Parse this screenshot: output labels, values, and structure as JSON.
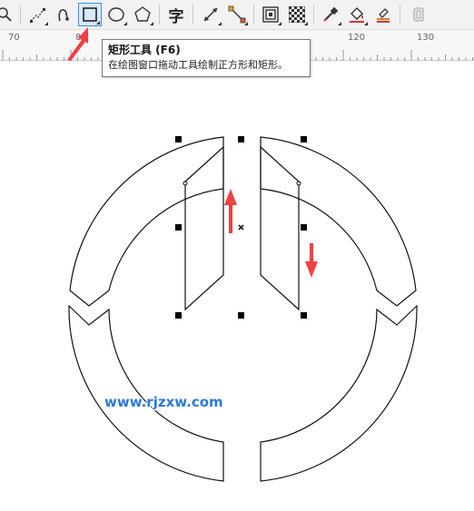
{
  "toolbar": {
    "items": [
      {
        "name": "zoom-tool",
        "icon": "magnifier-icon"
      },
      {
        "name": "freehand-tool",
        "icon": "polyline-icon"
      },
      {
        "name": "artistic-media-tool",
        "icon": "curve-icon"
      },
      {
        "name": "rectangle-tool",
        "icon": "rectangle-icon",
        "active": true
      },
      {
        "name": "ellipse-tool",
        "icon": "ellipse-icon"
      },
      {
        "name": "polygon-tool",
        "icon": "polygon-icon"
      },
      {
        "name": "text-tool",
        "icon": "text-icon",
        "label": "字"
      },
      {
        "name": "dimension-tool",
        "icon": "parallel-dimension-icon"
      },
      {
        "name": "connector-tool",
        "icon": "connector-icon"
      },
      {
        "name": "contour-tool",
        "icon": "contour-icon"
      },
      {
        "name": "transparency-tool",
        "icon": "checkerboard-icon"
      },
      {
        "name": "eyedropper-tool",
        "icon": "eyedropper-icon"
      },
      {
        "name": "fill-tool",
        "icon": "paint-bucket-icon"
      },
      {
        "name": "smart-fill-tool",
        "icon": "smart-fill-icon"
      },
      {
        "name": "lock-tool",
        "icon": "lock-icon"
      }
    ]
  },
  "ruler": {
    "labels": [
      "70",
      "80",
      "120",
      "130"
    ]
  },
  "tooltip": {
    "title": "矩形工具 (F6)",
    "description": "在绘图窗口拖动工具绘制正方形和矩形。"
  },
  "watermark": {
    "text": "www.rjzxw.com"
  },
  "colors": {
    "accent": "#3a8ee6",
    "arrow": "#f04040",
    "watermark": "#2c7ad9",
    "outline": "#111111"
  }
}
